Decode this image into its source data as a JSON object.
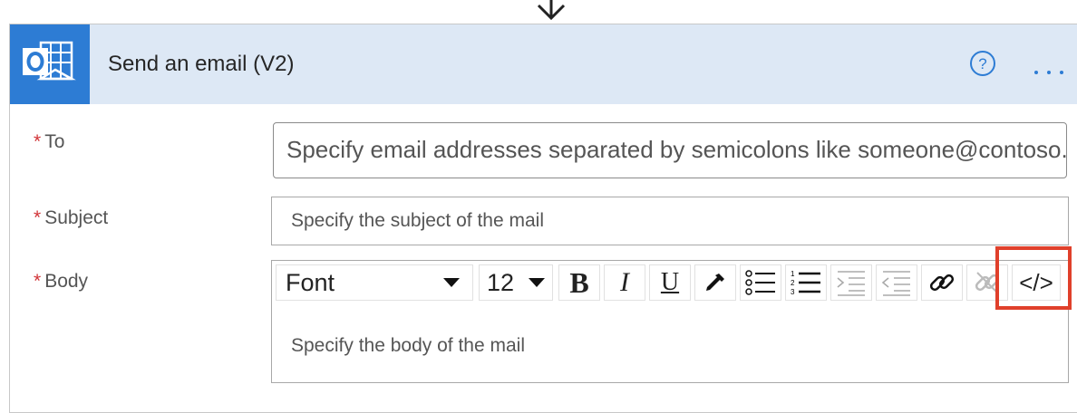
{
  "action": {
    "title": "Send an email (V2)",
    "icons": {
      "app": "outlook-icon",
      "help": "help-icon",
      "more": "more-options-icon",
      "connector": "down-arrow-icon"
    }
  },
  "fields": {
    "required_marker": "*",
    "to": {
      "label": "To",
      "placeholder": "Specify email addresses separated by semicolons like someone@contoso.com"
    },
    "subject": {
      "label": "Subject",
      "placeholder": "Specify the subject of the mail"
    },
    "body": {
      "label": "Body",
      "placeholder": "Specify the body of the mail",
      "toolbar": {
        "font": "Font",
        "size": "12",
        "bold": "B",
        "italic": "I",
        "underline": "U",
        "code_view": "</>"
      }
    }
  },
  "colors": {
    "accent": "#2d7cd4",
    "header_bg": "#dde8f5",
    "required": "#d13438",
    "highlight": "#e0402b"
  }
}
